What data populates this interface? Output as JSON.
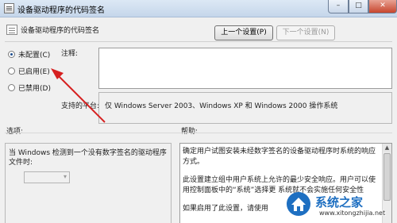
{
  "window": {
    "title": "设备驱动程序的代码签名"
  },
  "header": {
    "title": "设备驱动程序的代码签名",
    "prev_label": "上一个设置(P)",
    "next_label": "下一个设置(N)"
  },
  "radios": [
    {
      "label": "未配置(C)",
      "checked": true
    },
    {
      "label": "已启用(E)",
      "checked": false
    },
    {
      "label": "已禁用(D)",
      "checked": false
    }
  ],
  "comment": {
    "label": "注释:"
  },
  "supported": {
    "label": "支持的平台:",
    "value": "仅 Windows Server 2003、Windows XP 和 Windows 2000 操作系统"
  },
  "options": {
    "label": "选项:",
    "text": "当 Windows 检测到一个没有数字签名的驱动程序文件时:"
  },
  "help": {
    "label": "帮助:",
    "paragraphs": [
      "确定用户试图安装未经数字签名的设备驱动程序时系统的响应方式。",
      "此设置建立组中用户系统上允许的最少安全响应。用户可以使用控制面板中的“系统”选择更 系统就不会实施任何安全性",
      "如果启用了此设置，请使用"
    ]
  },
  "watermark": {
    "name": "系统之家",
    "url": "www.xitongzhijia.net"
  },
  "colors": {
    "accent": "#1d4e8f",
    "annotation_arrow": "#d62020",
    "watermark": "#1e6fc1"
  }
}
